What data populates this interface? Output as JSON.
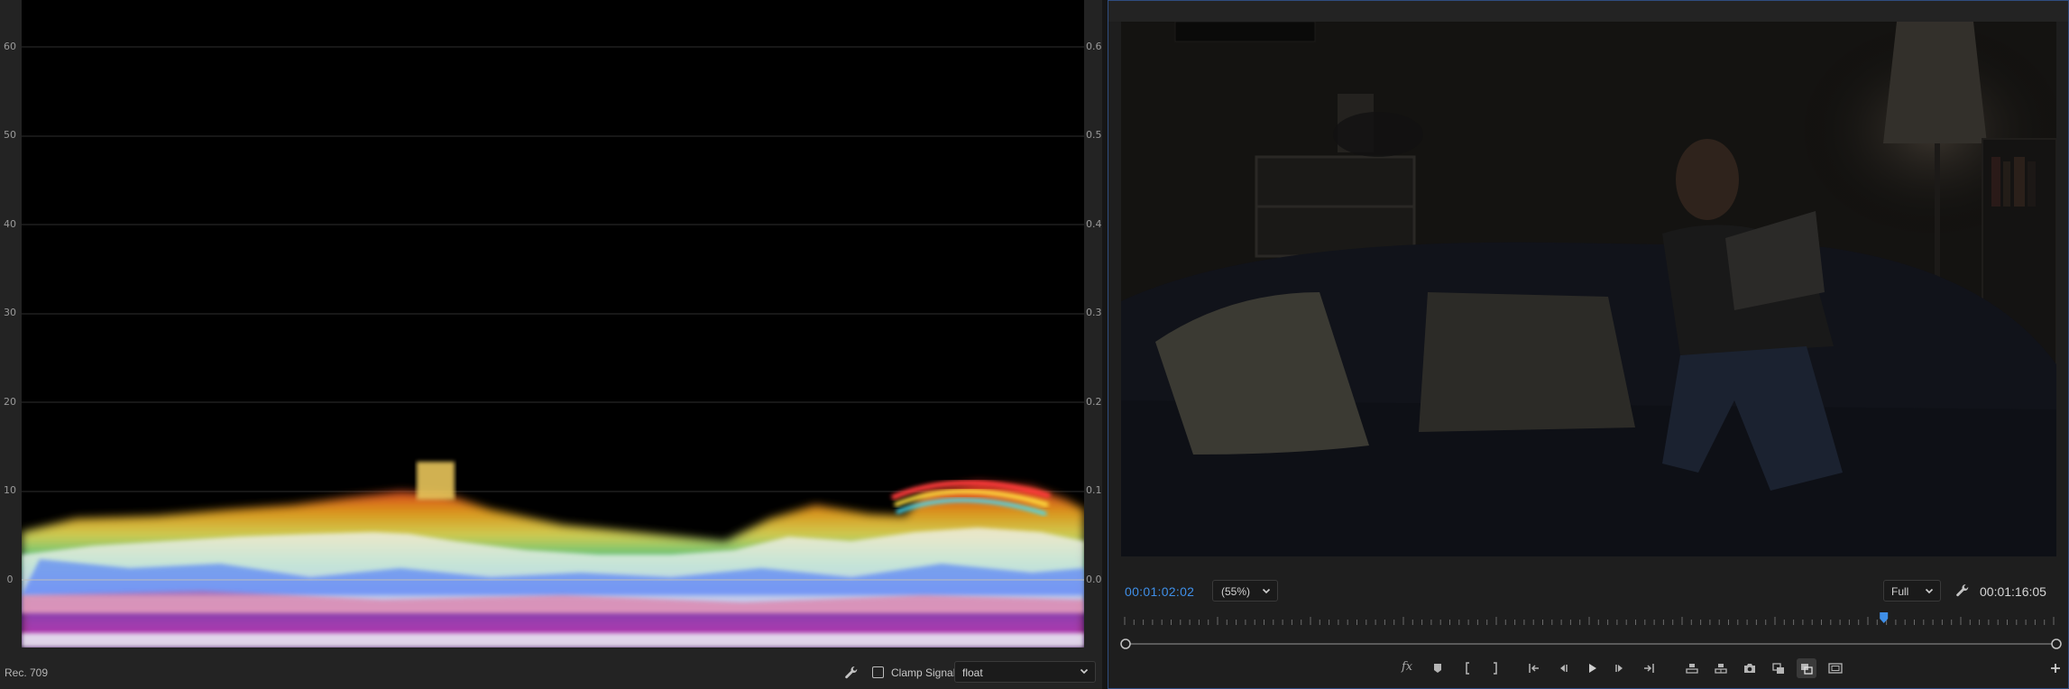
{
  "scopes": {
    "colorspace_label": "Rec. 709",
    "clamp_signal_label": "Clamp Signal",
    "clamp_signal_checked": false,
    "precision_value": "float",
    "axis_left_labels": [
      "60",
      "50",
      "40",
      "30",
      "20",
      "10",
      "0"
    ],
    "axis_right_labels": [
      "0.6",
      "0.5",
      "0.4",
      "0.3",
      "0.2",
      "0.1",
      "0.0"
    ],
    "icons": {
      "settings": "wrench-icon",
      "dropdown": "chevron-down-icon"
    }
  },
  "monitor": {
    "current_timecode": "00:01:02:02",
    "zoom_value": "(55%)",
    "resolution_value": "Full",
    "duration_timecode": "00:01:16:05",
    "playhead_fraction": 0.818,
    "icons": {
      "settings": "wrench-icon",
      "transport": [
        "fx-icon",
        "marker-icon",
        "mark-in-icon",
        "mark-out-icon",
        "go-to-in-icon",
        "step-back-icon",
        "play-icon",
        "step-forward-icon",
        "go-to-out-icon",
        "lift-icon",
        "extract-icon",
        "export-frame-icon",
        "comparison-view-icon",
        "toggle-proxies-icon",
        "safe-margins-icon",
        "add-button-icon"
      ]
    }
  },
  "colors": {
    "accent_blue": "#3f8fe8",
    "panel_border_blue": "#2f4d80"
  }
}
